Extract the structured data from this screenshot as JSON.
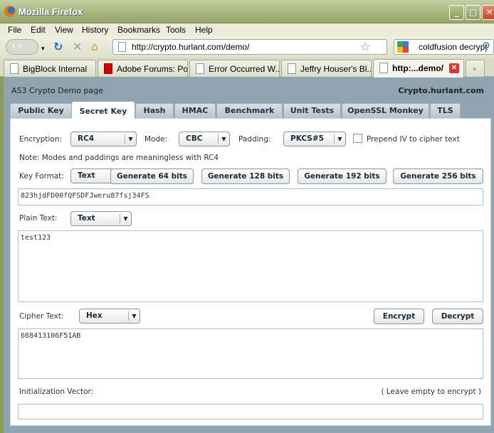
{
  "window": {
    "title": "Mozilla Firefox"
  },
  "menu": [
    "File",
    "Edit",
    "View",
    "History",
    "Bookmarks",
    "Tools",
    "Help"
  ],
  "nav": {
    "url": "http://crypto.hurlant.com/demo/",
    "search": "coldfusion decrypt"
  },
  "browser_tabs": [
    "BigBlock Internal",
    "Adobe Forums: Po...",
    "Error Occurred W...",
    "Jeffry Houser's Bl...",
    "http:...demo/"
  ],
  "page": {
    "header": "AS3 Crypto Demo page",
    "brand": "Crypto.hurlant.com"
  },
  "tabs": [
    "Public Key",
    "Secret Key",
    "Hash",
    "HMAC",
    "Benchmark",
    "Unit Tests",
    "OpenSSL Monkey",
    "TLS"
  ],
  "form": {
    "encryption_label": "Encryption:",
    "encryption": "RC4",
    "mode_label": "Mode:",
    "mode": "CBC",
    "padding_label": "Padding:",
    "padding": "PKCS#5",
    "prepend_label": "Prepend IV to cipher text",
    "note": "Note: Modes and paddings are meaningless with RC4",
    "key_format_label": "Key Format:",
    "key_format": "Text",
    "gen": [
      "Generate 64 bits",
      "Generate 128 bits",
      "Generate 192 bits",
      "Generate 256 bits"
    ],
    "key": "823hjdFD00fQFSDFJweru87fsj34FS",
    "plain_label": "Plain Text:",
    "plain_format": "Text",
    "plain": "test123",
    "cipher_label": "Cipher Text:",
    "cipher_format": "Hex",
    "cipher": "668413106F51AB",
    "encrypt": "Encrypt",
    "decrypt": "Decrypt",
    "iv_label": "Initialization Vector:",
    "iv_hint": "( Leave empty to encrypt )",
    "iv": ""
  }
}
